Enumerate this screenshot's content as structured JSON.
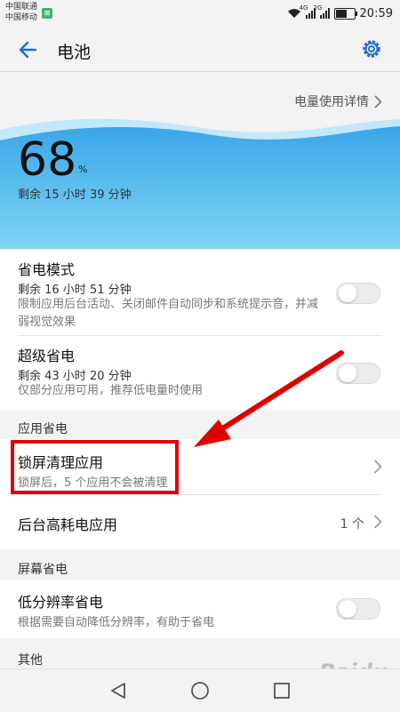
{
  "status_bar": {
    "carrier1": "中国联通",
    "carrier2": "中国移动",
    "volte_badge": "⊠",
    "sim1_tag": "4G",
    "sim2_tag": "2G",
    "battery_level": 0.68,
    "time": "20:59"
  },
  "app_bar": {
    "title": "电池",
    "back_icon": "arrow-left-icon",
    "settings_icon": "gear-icon"
  },
  "usage_link": "电量使用详情",
  "battery": {
    "percent": "68",
    "percent_sign": "%",
    "remaining": "剩余 15 小时 39 分钟"
  },
  "power_saving": {
    "title": "省电模式",
    "sub": "剩余 16 小时 51 分钟",
    "desc": "限制应用后台活动、关闭邮件自动同步和系统提示音，并减弱视觉效果",
    "enabled": false
  },
  "ultra_saving": {
    "title": "超级省电",
    "sub": "剩余 43 小时 20 分钟",
    "desc": "仅部分应用可用，推荐低电量时使用",
    "enabled": false
  },
  "sections": {
    "app_saving": "应用省电",
    "screen_saving": "屏幕省电",
    "other": "其他"
  },
  "lock_clean": {
    "title": "锁屏清理应用",
    "sub": "锁屏后，5 个应用不会被清理"
  },
  "background_drain": {
    "title": "后台高耗电应用",
    "count": "1 个"
  },
  "low_res": {
    "title": "低分辨率省电",
    "desc": "根据需要自动降低分辨率，有助于省电",
    "enabled": false
  },
  "colors": {
    "accent": "#1a6fd1",
    "hero_top": "#3aa6e8",
    "hero_bottom": "#7fd6f5",
    "annotation": "#e00000"
  },
  "watermark": {
    "brand": "Baidu",
    "sub": "经验"
  }
}
